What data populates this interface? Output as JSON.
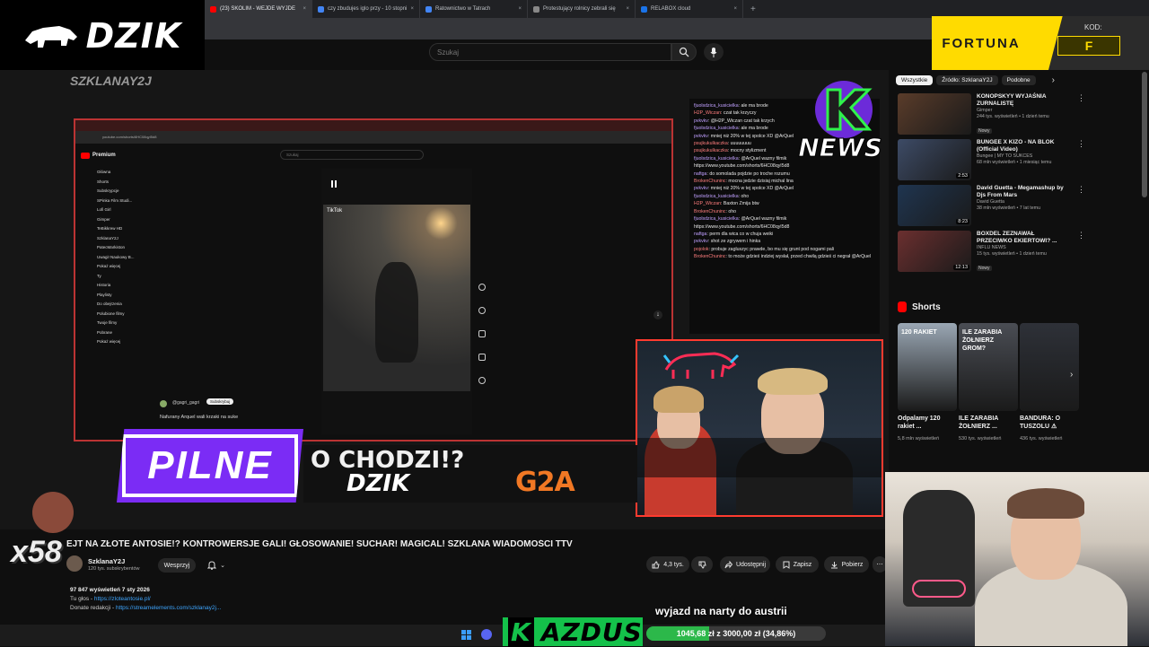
{
  "browser": {
    "tabs": [
      {
        "label": "(23) SKOLIM - WEJDE WYJDE",
        "fav": "#ff0000",
        "active": true
      },
      {
        "label": "czy zbudujes iglo przy - 10 stopni",
        "fav": "#4285f4",
        "active": false
      },
      {
        "label": "Ratownictwo w Tatrach",
        "fav": "#4285f4",
        "active": false
      },
      {
        "label": "Protestujący rolnicy zebrali się",
        "fav": "#888888",
        "active": false
      },
      {
        "label": "RELABOX cloud",
        "fav": "#1a73e8",
        "active": false
      }
    ],
    "new_tab_icon": "+"
  },
  "overlay": {
    "logo_text": "DZIK",
    "channel_watermark": "SZKLANAY2J",
    "pilne": "PILNE",
    "ticker_text": "O CHODZI!?",
    "ticker_sponsor_1": "DZIK",
    "ticker_sponsor_2": "G2A",
    "counter": "x58",
    "news_badge": "NEWS",
    "kazdus_k": "K",
    "kazdus_name": "AZDUS",
    "goal_title": "wyjazd na narty do austrii",
    "goal_label": "1045,68 zł z 3000,00 zł (34,86%)",
    "goal_fraction": 0.3486
  },
  "fortuna": {
    "brand": "FORTUNA",
    "code_label": "KOD:",
    "code_value": "F"
  },
  "youtube": {
    "search_placeholder": "Szukaj",
    "video_title": "EJT NA ZŁOTE ANTOSIE!? KONTROWERSJE GALI! GŁOSOWANIE! SUCHAR! MAGICAL! SZKLANA WIADOMOŚCI TTV",
    "channel_name": "SzklanaY2J",
    "channel_subs": "120 tys. subskrybentów",
    "support_label": "Wesprzyj",
    "like_count": "4,3 tys.",
    "share_label": "Udostępnij",
    "save_label": "Zapisz",
    "download_label": "Pobierz",
    "desc_views": "97 847 wyświetleń  7 sty 2026",
    "desc_vote_prefix": "Tu głos - ",
    "desc_vote_link": "https://zloteantosie.pl/",
    "desc_donate_prefix": "Donate redakcji - ",
    "desc_donate_link": "https://streamelements.com/szklanay2j..."
  },
  "inner_youtube": {
    "search": "Szukaj",
    "sidebar": [
      "Główna",
      "Shorts",
      "Subskrypcje",
      "SPinka Film Studi...",
      "Lofi Girl",
      "Gimper",
      "TeBikkrew HD",
      "SzklanaY2J",
      "PatecMarkiston",
      "Uwagi! Naukowy B...",
      "Pokaż więcej",
      "Ty",
      "Historia",
      "Playlisty",
      "Do obejrzenia",
      "Polubione filmy",
      "Twoje filmy",
      "Pobrane",
      "Pokaż więcej"
    ],
    "comment_user": "@gagri_gagri",
    "comment_tag": "Subskrybuj",
    "comment_text": "Nafurany Arquel wali krzaki na suke",
    "tiktok": "TikTok"
  },
  "chat": [
    {
      "u": "fjuolsdzica_kusicielka",
      "t": "ale ma brode",
      "c": "u1"
    },
    {
      "u": "H2P_Wiczan",
      "t": "czat tak krzyczy",
      "c": "u2"
    },
    {
      "u": "pvkvkv",
      "t": "@H2P_Wiczan czat tak krzych",
      "c": "u1"
    },
    {
      "u": "fjuolsdzica_kusicielka",
      "t": "ale ma brode",
      "c": "u1"
    },
    {
      "u": "pvkvkv",
      "t": "mniej niż 20% w tej spolce XD @ArQuel",
      "c": "u1"
    },
    {
      "u": "psujkukulkaczka",
      "t": "uuuuuuuu",
      "c": "u2"
    },
    {
      "u": "psujkukulkaczka",
      "t": "mocny stylizment",
      "c": "u2"
    },
    {
      "u": "fjuolsdzica_kusicielka",
      "t": "@ArQuel wazny filmik https://www.youtube.com/shorts/6HC08qyI5d8",
      "c": "u1"
    },
    {
      "u": "naftga",
      "t": "do somolada pojdzie po troche rozumu",
      "c": "u1"
    },
    {
      "u": "BrokenChuninc",
      "t": "mocna jedzie dzisiaj michal lina",
      "c": "u2"
    },
    {
      "u": "pvkvkv",
      "t": "mniej niż 20% w tej spolce XD @ArQuel",
      "c": "u1"
    },
    {
      "u": "fjuolsdzica_kusicielka",
      "t": "oho",
      "c": "u1"
    },
    {
      "u": "H2P_Wiczan",
      "t": "Baxton  Zmija btw",
      "c": "u2"
    },
    {
      "u": "BrokenChuninc",
      "t": "oho",
      "c": "u2"
    },
    {
      "u": "fjuolsdzica_kusicielka",
      "t": "@ArQuel wazny filmik https://www.youtube.com/shorts/6HC08qyI5d8",
      "c": "u1"
    },
    {
      "u": "naftga",
      "t": "perm dla wica co w chuja weiki",
      "c": "u1"
    },
    {
      "u": "pvkvkv",
      "t": "shot ze zgrywem i hinka",
      "c": "u1"
    },
    {
      "u": "pojolok",
      "t": "probuje zagluszyc prawde, bo mu się grunt pod nogami pali",
      "c": "u2"
    },
    {
      "u": "BrokenChuninc",
      "t": "to może gdzieś indziej wysłał, przed chwilą gdzieś ci negrał @ArQuel",
      "c": "u2"
    }
  ],
  "sidebar": {
    "chips": [
      "Wszystkie",
      "Źródło: SzklanaY2J",
      "Podobne"
    ],
    "recommendations": [
      {
        "title": "KONOPSKYY WYJAŚNIA ZURNALISTĘ",
        "channel": "Gimper",
        "meta": "244 tys. wyświetleń • 1 dzień temu",
        "badge": "Nowy",
        "duration": "",
        "color": "#5a3c2a"
      },
      {
        "title": "BUNGEE X KIZO - NA BLOK (Official Video)",
        "channel": "Bungee | MY TO SUKCES",
        "meta": "68 mln wyświetleń • 1 miesiąc temu",
        "badge": "",
        "duration": "2:53",
        "color": "#3d4b66"
      },
      {
        "title": "David Guetta - Megamashup by Djs From Mars",
        "channel": "David Guetta",
        "meta": "38 mln wyświetleń • 7 lat temu",
        "badge": "",
        "duration": "8:23",
        "color": "#1f3550"
      },
      {
        "title": "BOXDEL ZEZNAWAŁ PRZECIWKO EKIERTOWI? ...",
        "channel": "INFLU NEWS",
        "meta": "15 tys. wyświetleń • 1 dzień temu",
        "badge": "Nowy",
        "duration": "12:13",
        "color": "#6b2f2f"
      }
    ],
    "shorts_title": "Shorts",
    "shorts": [
      {
        "title": "Odpalamy 120 rakiet ...",
        "views": "5,8 mln wyświetleń",
        "color": "#9aa7b4",
        "caption": "120 RAKIET"
      },
      {
        "title": "ILE ZARABIA ŻOŁNIERZ ...",
        "views": "530 tys. wyświetleń",
        "color": "#4a4d54",
        "caption": "ILE ZARABIA ŻOŁNIERZ GROM?"
      },
      {
        "title": "BANDURA: O TUSZOLU ⚠",
        "views": "436 tys. wyświetleń",
        "color": "#2e3138",
        "caption": ""
      }
    ]
  },
  "colors": {
    "accent_red": "#ff3b2f",
    "pilne_purple": "#7b2cf5",
    "kazdus_green": "#14c14a",
    "fortuna_yellow": "#ffdb00",
    "link_blue": "#3ea6ff"
  },
  "icons": {
    "search": "search-icon",
    "mic": "mic-icon",
    "like": "thumbs-up-icon",
    "dislike": "thumbs-down-icon",
    "share": "share-icon",
    "save": "save-icon",
    "download": "download-icon",
    "bell": "bell-icon",
    "more": "more-vert-icon"
  }
}
